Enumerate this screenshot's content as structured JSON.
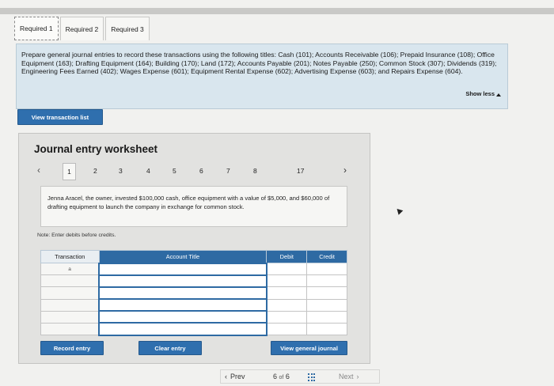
{
  "tabs": [
    {
      "label": "Required 1"
    },
    {
      "label": "Required 2"
    },
    {
      "label": "Required 3"
    }
  ],
  "instructions": {
    "text": "Prepare general journal entries to record these transactions using the following titles: Cash (101); Accounts Receivable (106); Prepaid Insurance (108); Office Equipment (163); Drafting Equipment (164); Building (170); Land (172); Accounts Payable (201); Notes Payable (250); Common Stock (307); Dividends (319); Engineering Fees Earned (402); Wages Expense (601); Equipment Rental Expense (602); Advertising Expense (603); and Repairs Expense (604).",
    "show_less": "Show less"
  },
  "buttons": {
    "view_transaction_list": "View transaction list",
    "record_entry": "Record entry",
    "clear_entry": "Clear entry",
    "view_general_journal": "View general journal"
  },
  "worksheet": {
    "title": "Journal entry worksheet",
    "pages": [
      "1",
      "2",
      "3",
      "4",
      "5",
      "6",
      "7",
      "8",
      "17"
    ],
    "active_page": "1",
    "transaction_text": "Jenna Aracel, the owner, invested $100,000 cash, office equipment with a value of $5,000, and $60,000 of drafting equipment to launch the company in exchange for common stock.",
    "note": "Note: Enter debits before credits.",
    "columns": {
      "transaction": "Transaction",
      "account_title": "Account Title",
      "debit": "Debit",
      "credit": "Credit"
    },
    "first_transaction_label": "a"
  },
  "footer": {
    "prev": "Prev",
    "page_current": "6",
    "page_of": "of",
    "page_total": "6",
    "next": "Next"
  },
  "colors": {
    "accent": "#2e6aa3",
    "instructions_bg": "#d9e6ee"
  }
}
